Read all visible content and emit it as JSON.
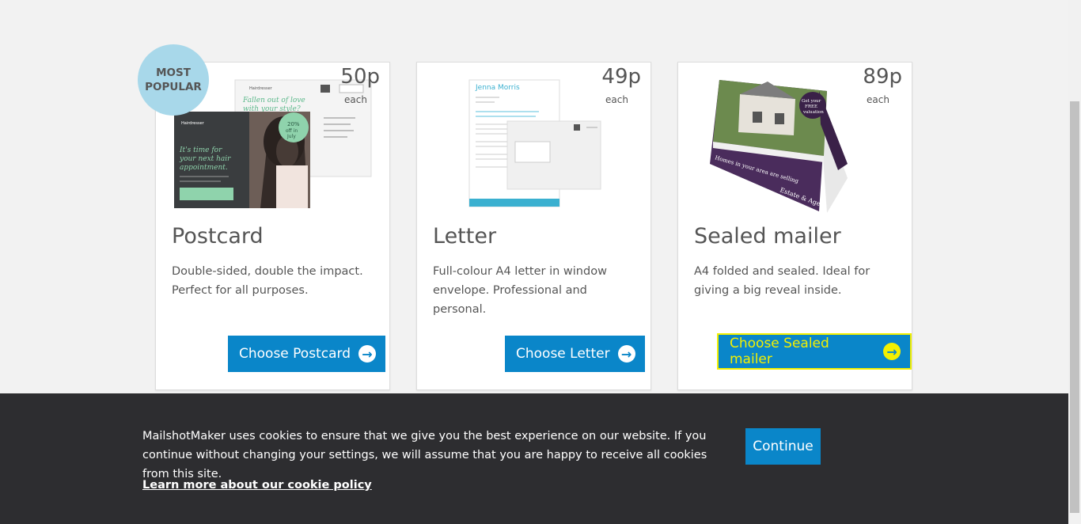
{
  "cards": [
    {
      "price": "50p",
      "each": "each",
      "title": "Postcard",
      "description": "Double-sided, double the impact. Perfect for all purposes.",
      "cta": "Choose Postcard",
      "badge_line1": "MOST",
      "badge_line2": "POPULAR",
      "image_text": {
        "brand": "Hairdresser",
        "headline": "It's time for your next hair appointment.",
        "back_headline": "Fallen out of love with your style?",
        "offer": "20% off in July"
      }
    },
    {
      "price": "49p",
      "each": "each",
      "title": "Letter",
      "description": "Full-colour A4 letter in window envelope. Professional and personal.",
      "cta": "Choose Letter",
      "image_text": {
        "name": "Jenna Morris"
      }
    },
    {
      "price": "89p",
      "each": "each",
      "title": "Sealed mailer",
      "description": "A4 folded and sealed. Ideal for giving a big reveal inside.",
      "cta": "Choose Sealed mailer",
      "image_text": {
        "badge": "Get your FREE valuation",
        "brand": "Estate & Agent"
      }
    }
  ],
  "cookie": {
    "text": "MailshotMaker uses cookies to ensure that we give you the best experience on our website. If you continue without changing your settings, we will assume that you are happy to receive all cookies from this site.",
    "link": "Learn more about our cookie policy",
    "button": "Continue"
  },
  "colors": {
    "accent": "#0a86c9",
    "focus": "#f3f000",
    "badge": "#a8d8ea",
    "cookie_bg": "#2d2d30"
  }
}
